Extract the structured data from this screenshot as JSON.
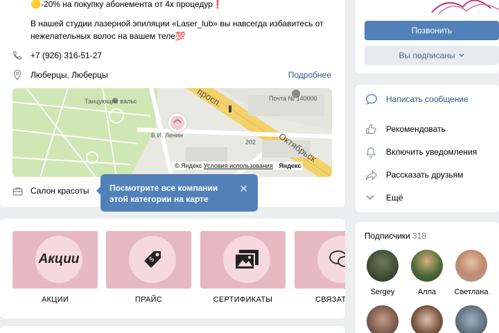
{
  "info": {
    "promo_top": "🟡-20% на покупку абонемента от 4х процедур❗",
    "description_1": "В нашей студии лазерной эпиляции «Laser_lub» вы навсегда избавитесь от",
    "description_2": "нежелательных волос на вашем теле💯",
    "phone": "+7 (926) 316-51-27",
    "address": "Люберцы, Люберцы",
    "more_link": "Подробнее",
    "category": "Салон красоты"
  },
  "map": {
    "label_park": "Танцующие вальс",
    "label_post": "Почта № 140000",
    "label_street1": "просп.",
    "label_street2": "Октябрьск",
    "label_lenin": "В.И. Ленин",
    "label_num": "202",
    "copyright": "© Яндекс",
    "terms": "Условия использования",
    "yandex": "Яндекс"
  },
  "tooltip": {
    "text": "Посмотрите все компании этой категории на карте",
    "close": "✕"
  },
  "gallery": {
    "items": [
      {
        "caption": "АКЦИИ",
        "tile_text": "Акции",
        "icon": "text"
      },
      {
        "caption": "ПРАЙС",
        "tile_text": "",
        "icon": "price-tag-icon"
      },
      {
        "caption": "СЕРТИФИКАТЫ",
        "tile_text": "",
        "icon": "photos-icon"
      },
      {
        "caption": "СВЯЗАТЬСЯ",
        "tile_text": "",
        "icon": "chat-icon"
      }
    ]
  },
  "actions": {
    "call": "Позвонить",
    "subscribed": "Вы подписаны"
  },
  "menu": {
    "items": [
      {
        "label": "Написать сообщение",
        "icon": "message-icon"
      },
      {
        "label": "Рекомендовать",
        "icon": "thumbs-up-icon"
      },
      {
        "label": "Включить уведомления",
        "icon": "bell-icon"
      },
      {
        "label": "Рассказать друзьям",
        "icon": "share-icon"
      },
      {
        "label": "Ещё",
        "icon": "chevron-down-icon"
      }
    ]
  },
  "followers": {
    "title": "Подписчики",
    "count": "318",
    "people": [
      {
        "name": "Sergey"
      },
      {
        "name": "Алла"
      },
      {
        "name": "Светлана"
      },
      {
        "name": ""
      },
      {
        "name": ""
      },
      {
        "name": ""
      }
    ]
  },
  "colors": {
    "accent": "#5181b8",
    "link": "#2a5885",
    "background": "#edeef0",
    "tile_pink": "#e6b9c2"
  }
}
